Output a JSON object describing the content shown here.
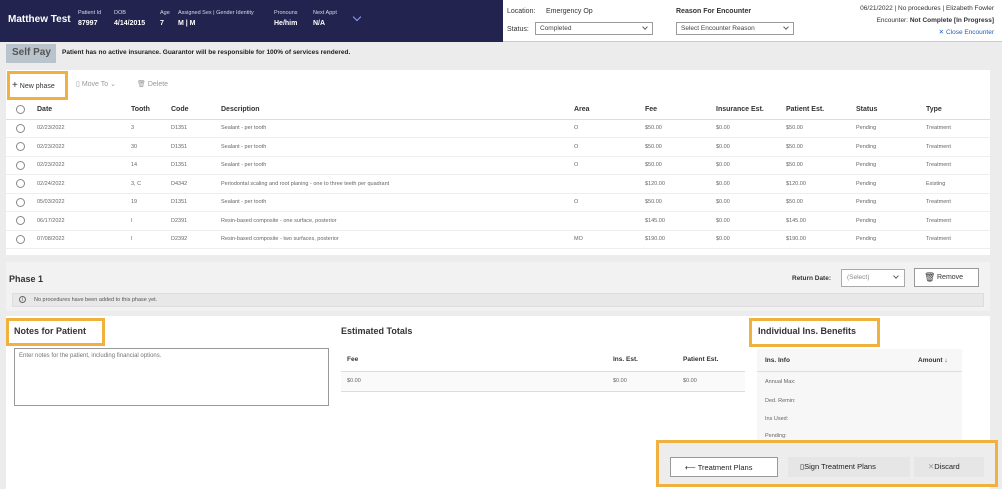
{
  "patient": {
    "name": "Matthew Test",
    "fields": [
      {
        "label": "Patient Id",
        "value": "87997"
      },
      {
        "label": "DOB",
        "value": "4/14/2015"
      },
      {
        "label": "Age",
        "value": "7"
      },
      {
        "label": "Assigned Sex | Gender Identity",
        "value": "M | M"
      },
      {
        "label": "Pronouns",
        "value": "He/him"
      },
      {
        "label": "Next Appt",
        "value": "N/A"
      }
    ]
  },
  "encounter_header": {
    "location_label": "Location:",
    "location_value": "Emergency Op",
    "status_label": "Status:",
    "status_value": "Completed",
    "reason_label": "Reason For Encounter",
    "reason_placeholder": "Select Encounter Reason",
    "summary_line": "06/21/2022 | No procedures | Elizabeth Fowler",
    "encounter_label": "Encounter:",
    "encounter_status": "Not Complete [In Progress]",
    "close_encounter": "Close Encounter"
  },
  "insurance": {
    "badge": "Self Pay",
    "note": "Patient has no active insurance. Guarantor will be responsible for 100% of services rendered."
  },
  "toolbar": {
    "new_phase": "New phase",
    "move_to": "Move To",
    "delete": "Delete"
  },
  "procedures": {
    "columns": [
      "Date",
      "Tooth",
      "Code",
      "Description",
      "Area",
      "Fee",
      "Insurance Est.",
      "Patient Est.",
      "Status",
      "Type"
    ],
    "rows": [
      [
        "02/23/2022",
        "3",
        "D1351",
        "Sealant - per tooth",
        "O",
        "$50.00",
        "$0.00",
        "$50.00",
        "Pending",
        "Treatment"
      ],
      [
        "02/23/2022",
        "30",
        "D1351",
        "Sealant - per tooth",
        "O",
        "$50.00",
        "$0.00",
        "$50.00",
        "Pending",
        "Treatment"
      ],
      [
        "02/23/2022",
        "14",
        "D1351",
        "Sealant - per tooth",
        "O",
        "$50.00",
        "$0.00",
        "$50.00",
        "Pending",
        "Treatment"
      ],
      [
        "02/24/2022",
        "3, C",
        "D4342",
        "Periodontal scaling and root planing - one to three teeth per quadrant",
        "",
        "$120.00",
        "$0.00",
        "$120.00",
        "Pending",
        "Existing"
      ],
      [
        "05/03/2022",
        "19",
        "D1351",
        "Sealant - per tooth",
        "O",
        "$50.00",
        "$0.00",
        "$50.00",
        "Pending",
        "Treatment"
      ],
      [
        "06/17/2022",
        "I",
        "D2391",
        "Resin-based composite - one surface, posterior",
        "",
        "$145.00",
        "$0.00",
        "$145.00",
        "Pending",
        "Treatment"
      ],
      [
        "07/08/2022",
        "I",
        "D2392",
        "Resin-based composite - two surfaces, posterior",
        "MO",
        "$190.00",
        "$0.00",
        "$190.00",
        "Pending",
        "Treatment"
      ]
    ]
  },
  "phase": {
    "title": "Phase 1",
    "return_date_label": "Return Date:",
    "return_date_value": "(Select)",
    "remove": "Remove",
    "empty_message": "No procedures have been added to this phase yet."
  },
  "notes": {
    "title": "Notes for Patient",
    "placeholder": "Enter notes for the patient, including financial options."
  },
  "estimated_totals": {
    "title": "Estimated Totals",
    "columns": [
      "Fee",
      "Ins. Est.",
      "Patient Est."
    ],
    "values": [
      "$0.00",
      "$0.00",
      "$0.00"
    ]
  },
  "ins_benefits": {
    "title": "Individual Ins. Benefits",
    "col_info": "Ins. Info",
    "col_amount": "Amount",
    "rows": [
      "Annual Max:",
      "Ded. Remin:",
      "Ins Used:",
      "Pending:"
    ]
  },
  "footer": {
    "treatment_plans": "Treatment Plans",
    "sign": "Sign Treatment Plans",
    "discard": "Discard"
  },
  "colors": {
    "header_bg": "#22244f",
    "highlight": "#f0b13e",
    "link": "#1f5fbf"
  }
}
